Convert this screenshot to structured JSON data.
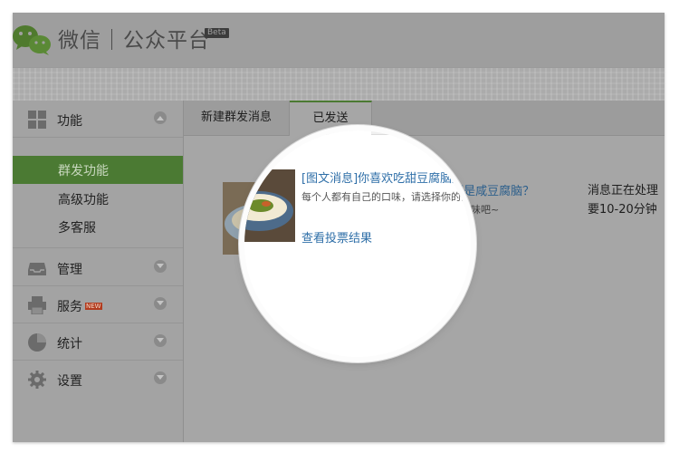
{
  "header": {
    "title": "微信｜公众平台",
    "beta": "Beta"
  },
  "sidebar": {
    "groups": [
      {
        "label": "功能",
        "icon": "grid-icon",
        "expanded": true,
        "items": [
          {
            "label": "群发功能",
            "active": true
          },
          {
            "label": "高级功能",
            "active": false
          },
          {
            "label": "多客服",
            "active": false
          }
        ]
      },
      {
        "label": "管理",
        "icon": "inbox-icon",
        "expanded": false
      },
      {
        "label": "服务",
        "icon": "printer-icon",
        "badge": "NEW",
        "expanded": false
      },
      {
        "label": "统计",
        "icon": "pie-chart-icon",
        "expanded": false
      },
      {
        "label": "设置",
        "icon": "gear-icon",
        "expanded": false
      }
    ]
  },
  "tabs": [
    {
      "label": "新建群发消息",
      "active": false
    },
    {
      "label": "已发送",
      "active": true
    }
  ],
  "message": {
    "title": "[图文消息]你喜欢吃甜豆腐脑还是咸豆腐脑？",
    "desc": "每个人都有自己的口味，请选择你的口味吧~",
    "link": "查看投票结果",
    "status": "消息正在处理\n要10-20分钟",
    "status_line1": "消息正在处理",
    "status_line2": "要10-20分钟"
  },
  "colors": {
    "accent_green": "#6aae45",
    "link_blue": "#2f6fa8",
    "badge_red": "#d44a26"
  }
}
